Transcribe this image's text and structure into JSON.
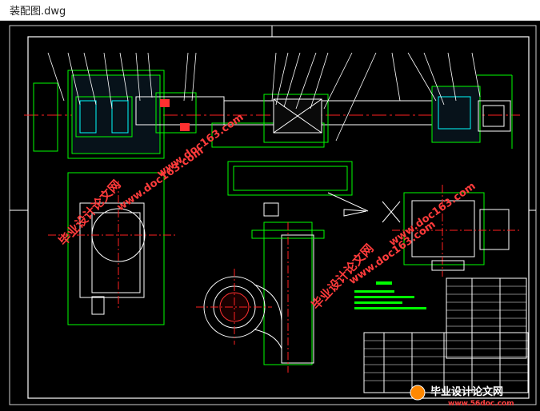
{
  "window": {
    "title": "装配图.dwg"
  },
  "watermarks": {
    "text_cn": "毕业设计论文网",
    "url": "www.doc163.com",
    "color_cn": "#ff3b3b",
    "color_url": "#ff3b3b"
  },
  "footer_logo": {
    "name": "毕业设计论文网",
    "url": "www.56doc.com"
  },
  "colors": {
    "background": "#000000",
    "frame": "#ffffff",
    "outline": "#00ff00",
    "centerline": "#ff2020",
    "leader": "#ffffff",
    "hatch": "#ff3030",
    "accent_green": "#00ff00",
    "accent_cyan": "#00ffff"
  }
}
